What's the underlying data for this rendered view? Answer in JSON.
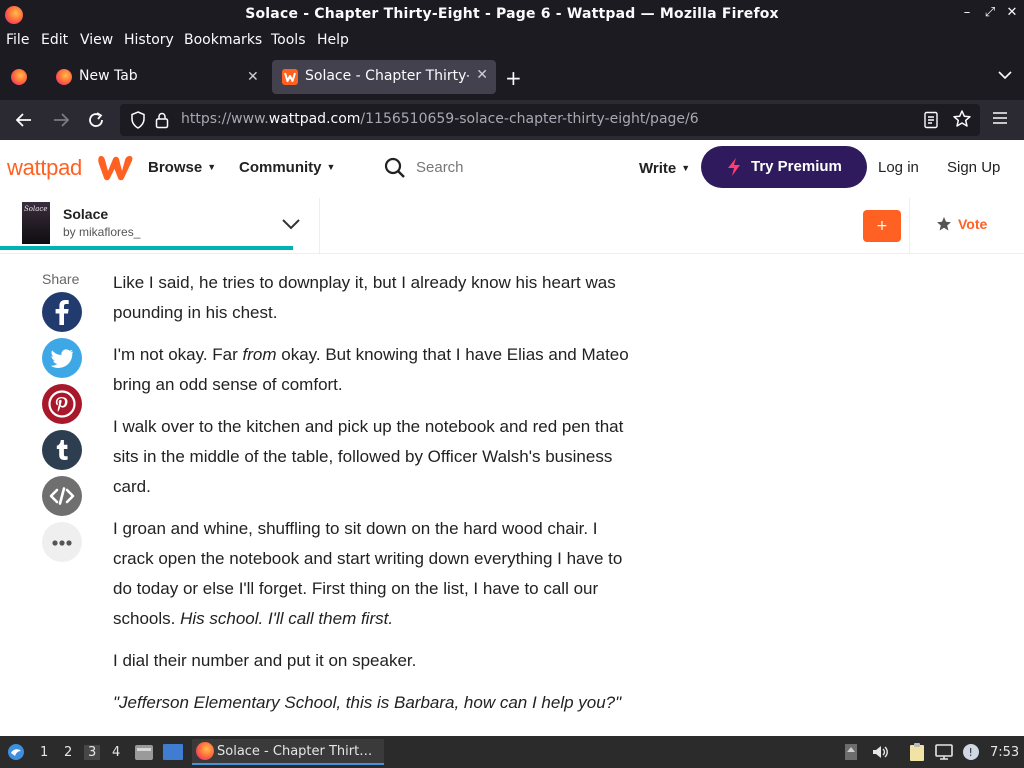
{
  "window": {
    "title": "Solace - Chapter Thirty-Eight - Page 6 - Wattpad — Mozilla Firefox",
    "minimize": "–",
    "maximize": "⤢",
    "close": "✕"
  },
  "menu": [
    "File",
    "Edit",
    "View",
    "History",
    "Bookmarks",
    "Tools",
    "Help"
  ],
  "tabs": [
    {
      "label": "New Tab",
      "close": "✕"
    },
    {
      "label": "Solace - Chapter Thirty-E",
      "close": "✕"
    }
  ],
  "new_tab": "+",
  "tabs_overflow": "⌄",
  "nav": {
    "url_prefix": "https://www.",
    "url_domain": "wattpad.com",
    "url_path": "/1156510659-solace-chapter-thirty-eight/page/6"
  },
  "wattpad": {
    "logo": "wattpad",
    "browse": "Browse",
    "community": "Community",
    "search_placeholder": "Search",
    "write": "Write",
    "premium": "Try Premium",
    "login": "Log in",
    "signup": "Sign Up",
    "brand_color": "#ff6122",
    "premium_color": "#2e1a5c"
  },
  "story": {
    "title": "Solace",
    "author": "by mikaflores_",
    "cover_text": "Solace",
    "add_label": "+",
    "vote_label": "Vote",
    "progress_accent": "#00b2b2"
  },
  "share": {
    "label": "Share",
    "buttons": [
      "facebook",
      "twitter",
      "pinterest",
      "tumblr",
      "embed",
      "more"
    ]
  },
  "reading": {
    "p1": "Like I said, he tries to downplay it, but I already know his heart was pounding in his chest.",
    "p2_a": "I'm not okay. Far ",
    "p2_em": "from",
    "p2_b": " okay. But knowing that I have Elias and Mateo bring an odd sense of comfort.",
    "p3": "I walk over to the kitchen and pick up the notebook and red pen that sits in the middle of the table, followed by Officer Walsh's business card.",
    "p4_a": "I groan and whine, shuffling to sit down on the hard wood chair. I crack open the notebook and start writing down everything I have to do today or else I'll forget. First thing on the list, I have to call our schools. ",
    "p4_em": "His school. I'll call them first.",
    "p5": "I dial their number and put it on speaker.",
    "p6": "\"Jefferson Elementary School, this is Barbara, how can I help you?\""
  },
  "taskbar": {
    "workspaces": [
      "1",
      "2",
      "3",
      "4"
    ],
    "active_workspace": "3",
    "task_label": "Solace - Chapter Thirt…",
    "clock": "7:53"
  }
}
